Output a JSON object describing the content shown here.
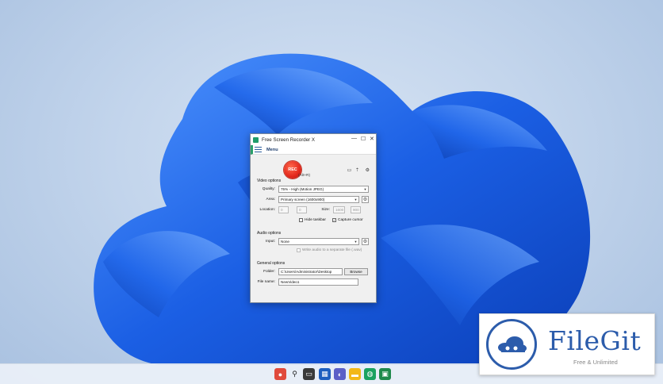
{
  "window": {
    "title": "Free Screen Recorder X",
    "controls": [
      "—",
      "☐",
      "✕"
    ],
    "menu_label": "Menu"
  },
  "recorder": {
    "rec_label": "REC",
    "hotkey": "(Alt+R)"
  },
  "video": {
    "section": "Video options",
    "quality_label": "Quality:",
    "quality_value": "75% - High (Motion JPEG)",
    "area_label": "Area:",
    "area_value": "Primary screen (1600x900)",
    "location_label": "Location:",
    "loc_x": "0",
    "loc_y": "0",
    "size_label": "Size:",
    "size_w": "1600",
    "size_h": "900",
    "hide_taskbar": "Hide taskbar",
    "hide_taskbar_checked": false,
    "capture_cursor": "Capture cursor",
    "capture_cursor_checked": true
  },
  "audio": {
    "section": "Audio options",
    "input_label": "Input:",
    "input_value": "None",
    "separate_file": "Write audio to a separate file (.wav)"
  },
  "general": {
    "section": "General options",
    "folder_label": "Folder:",
    "folder_value": "C:\\Users\\Administrator\\Desktop",
    "browse": "Browse",
    "filename_label": "File name:",
    "filename_value": "NewVideo1"
  },
  "watermark": {
    "name": "FileGit",
    "tagline": "Free & Unlimited"
  },
  "colors": {
    "rec": "#e3281c",
    "brand": "#2c5cab",
    "bloom": "#1a63e0"
  }
}
